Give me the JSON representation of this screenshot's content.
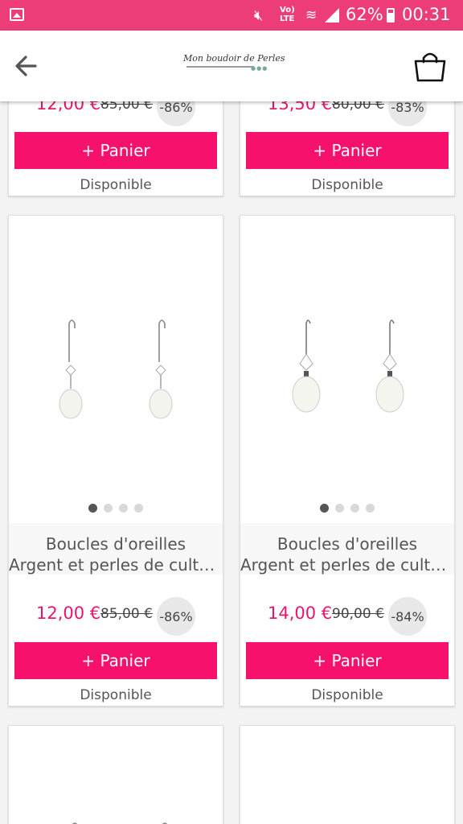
{
  "status_bar": {
    "volte_line1": "Vo)",
    "volte_line2": "LTE",
    "battery": "62%",
    "time": "00:31"
  },
  "header": {
    "logo_text": "Mon boudoir de Perles"
  },
  "top_cards": [
    {
      "price": "12,00 €",
      "old_price": "85,00 €",
      "discount": "-86%",
      "button": "+ Panier",
      "availability": "Disponible"
    },
    {
      "price": "13,50 €",
      "old_price": "80,00 €",
      "discount": "-83%",
      "button": "+ Panier",
      "availability": "Disponible"
    }
  ],
  "cards": [
    {
      "title_line1": "Boucles d'oreilles",
      "title_line2": "Argent et perles de cultu…",
      "price": "12,00 €",
      "old_price": "85,00 €",
      "discount": "-86%",
      "button": "+ Panier",
      "availability": "Disponible",
      "carousel_dots": 4,
      "active_dot": 1
    },
    {
      "title_line1": "Boucles d'oreilles",
      "title_line2": "Argent et perles de cultu…",
      "price": "14,00 €",
      "old_price": "90,00 €",
      "discount": "-84%",
      "button": "+ Panier",
      "availability": "Disponible",
      "carousel_dots": 4,
      "active_dot": 1
    }
  ],
  "colors": {
    "accent": "#f5116c",
    "status_bar": "#ec3d78",
    "price": "#e8156f"
  },
  "icons": [
    "image-icon",
    "mute-icon",
    "wifi-icon",
    "signal-icon",
    "battery-icon",
    "back-arrow-icon",
    "shopping-bag-icon"
  ]
}
